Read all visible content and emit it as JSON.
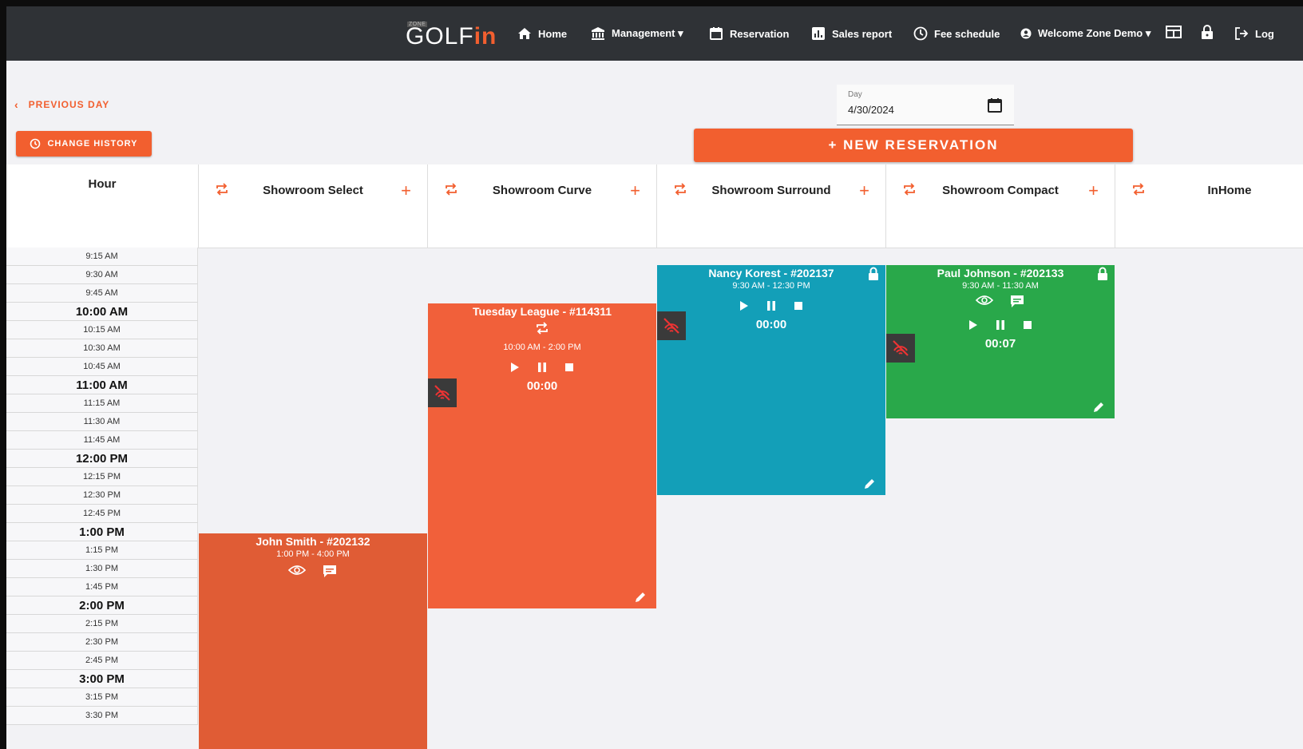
{
  "nav": {
    "logo_small": "ZONE",
    "logo_main": "GOLF",
    "logo_in": "in",
    "items": [
      {
        "label": "Home",
        "icon": "home-icon"
      },
      {
        "label": "Management ▾",
        "icon": "bank-icon"
      },
      {
        "label": "Reservation",
        "icon": "calendar-icon"
      },
      {
        "label": "Sales report",
        "icon": "bar-chart-icon"
      },
      {
        "label": "Fee schedule",
        "icon": "clock-icon"
      },
      {
        "label": "Welcome Zone Demo ▾",
        "icon": "user-circle-icon"
      }
    ],
    "logout_label": "Log"
  },
  "controls": {
    "previous_day": "PREVIOUS DAY",
    "change_history": "CHANGE HISTORY",
    "day_label": "Day",
    "day_value": "4/30/2024",
    "new_reservation": "+ NEW RESERVATION"
  },
  "grid": {
    "hour_header": "Hour",
    "columns": [
      "Showroom Select",
      "Showroom Curve",
      "Showroom Surround",
      "Showroom Compact",
      "InHome"
    ],
    "slots": [
      "9:15 AM",
      "9:30 AM",
      "9:45 AM",
      "10:00 AM",
      "10:15 AM",
      "10:30 AM",
      "10:45 AM",
      "11:00 AM",
      "11:15 AM",
      "11:30 AM",
      "11:45 AM",
      "12:00 PM",
      "12:15 PM",
      "12:30 PM",
      "12:45 PM",
      "1:00 PM",
      "1:15 PM",
      "1:30 PM",
      "1:45 PM",
      "2:00 PM",
      "2:15 PM",
      "2:30 PM",
      "2:45 PM",
      "3:00 PM",
      "3:15 PM",
      "3:30 PM"
    ]
  },
  "reservations": [
    {
      "title": "John Smith - #202132",
      "time": "1:00 PM - 4:00 PM",
      "color": "#e05c35"
    },
    {
      "title": "Tuesday League - #114311",
      "time": "10:00 AM - 2:00 PM",
      "timer": "00:00",
      "color": "#f1603a"
    },
    {
      "title": "Nancy Korest - #202137",
      "time": "9:30 AM - 12:30 PM",
      "timer": "00:00",
      "color": "#139fb8"
    },
    {
      "title": "Paul Johnson - #202133",
      "time": "9:30 AM - 11:30 AM",
      "timer": "00:07",
      "color": "#29a84a"
    }
  ],
  "colors": {
    "accent": "#f25f2f",
    "navbar": "#2f3236"
  }
}
